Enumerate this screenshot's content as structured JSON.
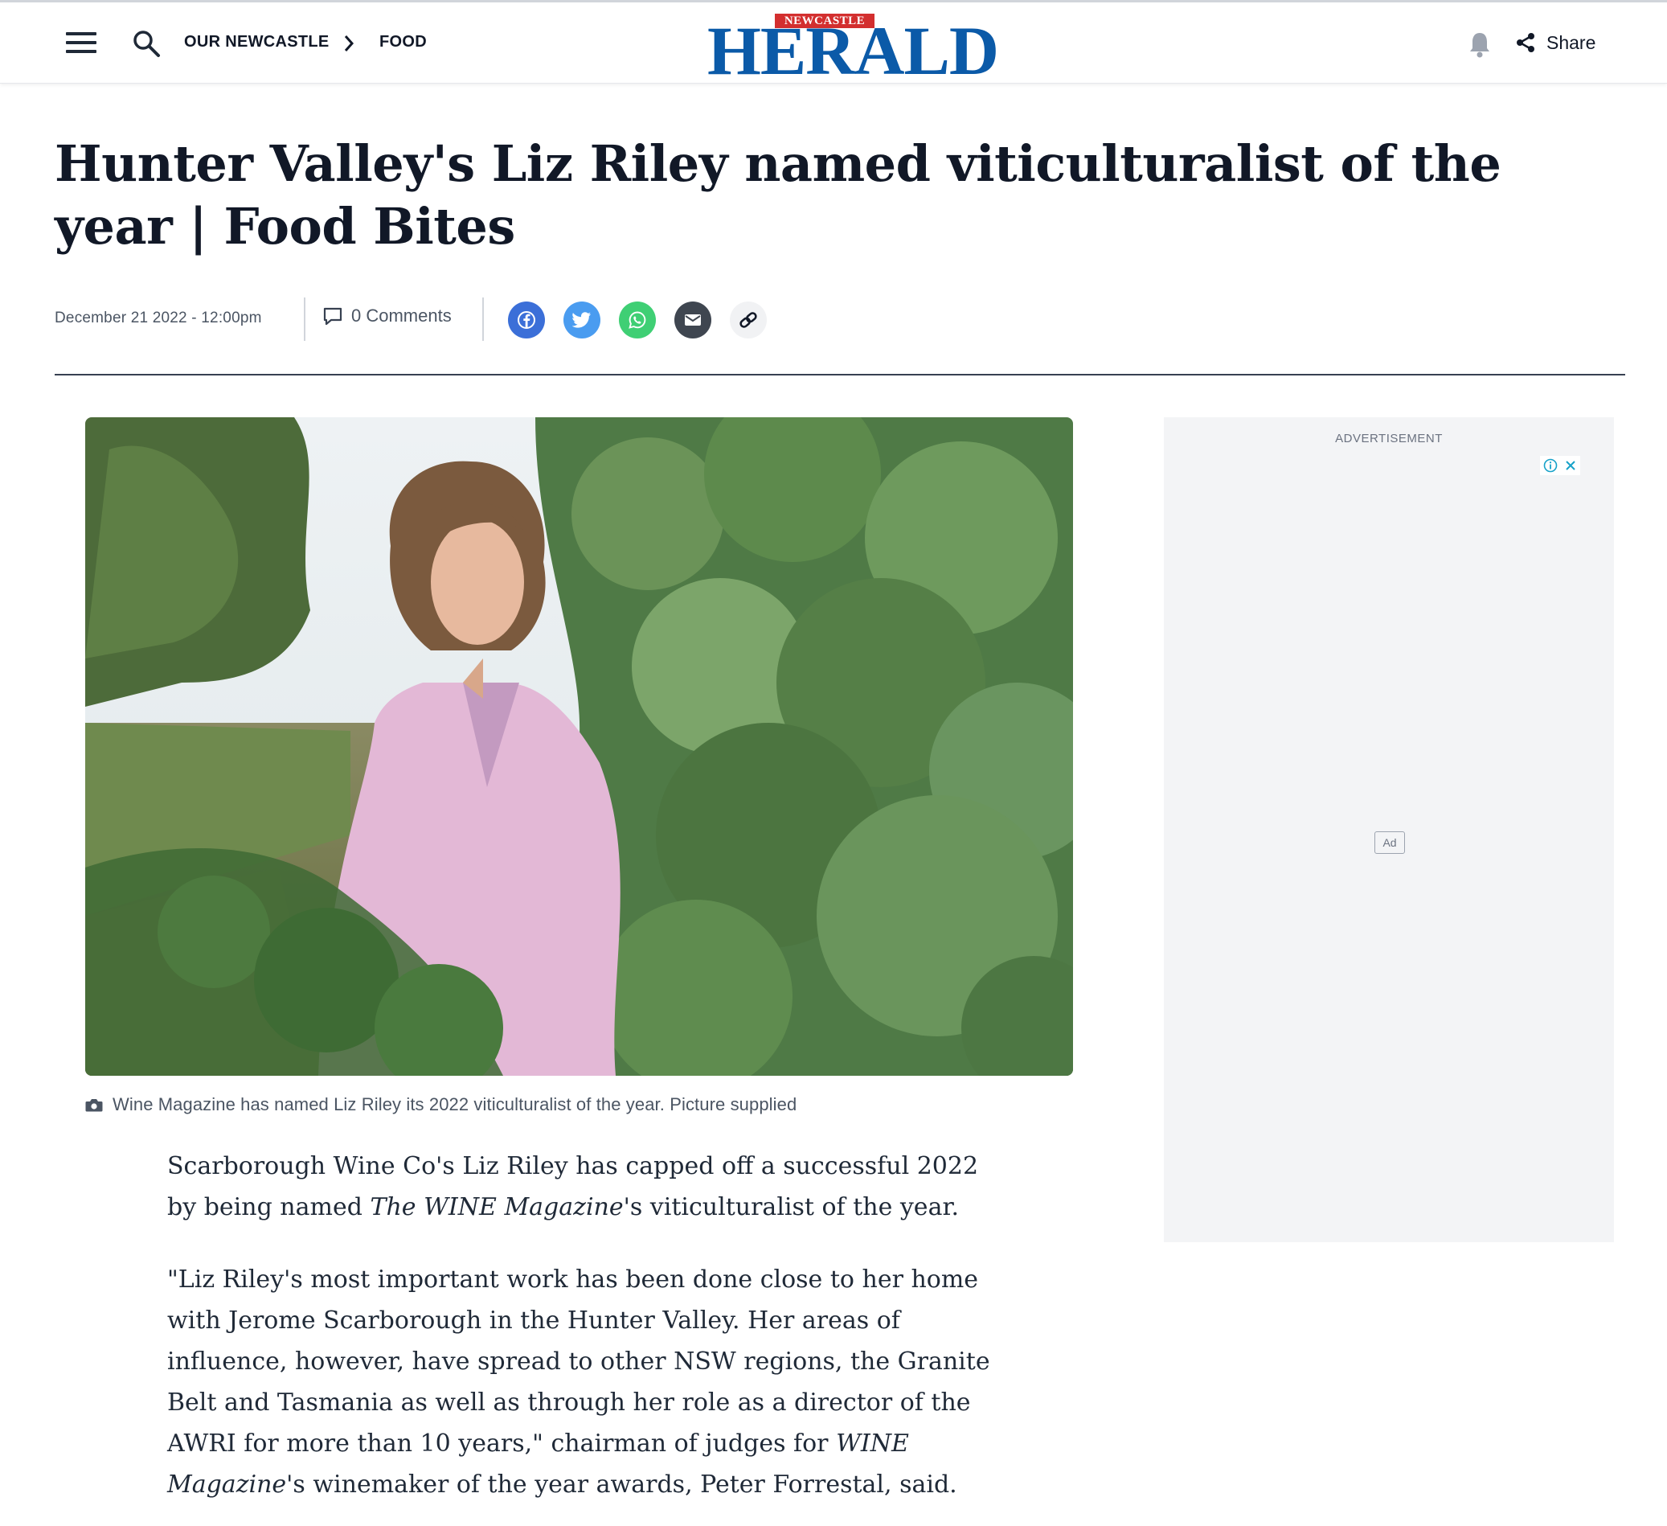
{
  "header": {
    "breadcrumbs": [
      "OUR NEWCASTLE",
      "FOOD"
    ],
    "logo": {
      "badge": "NEWCASTLE",
      "wordmark": "HERALD"
    },
    "share_label": "Share"
  },
  "article": {
    "headline": "Hunter Valley's Liz Riley named viticulturalist of the year | Food Bites",
    "date": "December 21 2022 - 12:00pm",
    "comments_label": "0 Comments",
    "social_buttons": [
      {
        "name": "facebook-icon",
        "color": "#3b6fd8"
      },
      {
        "name": "twitter-icon",
        "color": "#4a9cf0"
      },
      {
        "name": "whatsapp-icon",
        "color": "#3fcf74"
      },
      {
        "name": "email-icon",
        "color": "#3f4650"
      },
      {
        "name": "link-icon",
        "color": "#f1f2f4"
      }
    ],
    "photo_caption": "Wine Magazine has named Liz Riley its 2022 viticulturalist of the year. Picture supplied",
    "paragraphs": [
      {
        "a": "Scarborough Wine Co's Liz Riley has capped off a successful 2022 by being named ",
        "em": "The WINE Magazine",
        "b": "'s viticulturalist of the year."
      },
      {
        "a": "\"Liz Riley's most important work has been done close to her home with Jerome Scarborough in the Hunter Valley. Her areas of influence, however, have spread to other NSW regions, the Granite Belt and Tasmania as well as through her role as a director of the AWRI for more than 10 years,\" chairman of judges for ",
        "em": "WINE Magazine",
        "b": "'s winemaker of the year awards, Peter Forrestal, said."
      }
    ]
  },
  "advertisement": {
    "label": "ADVERTISEMENT",
    "badge": "Ad"
  },
  "colors": {
    "brand_blue": "#0b5aa8",
    "brand_red": "#d32f2f"
  }
}
